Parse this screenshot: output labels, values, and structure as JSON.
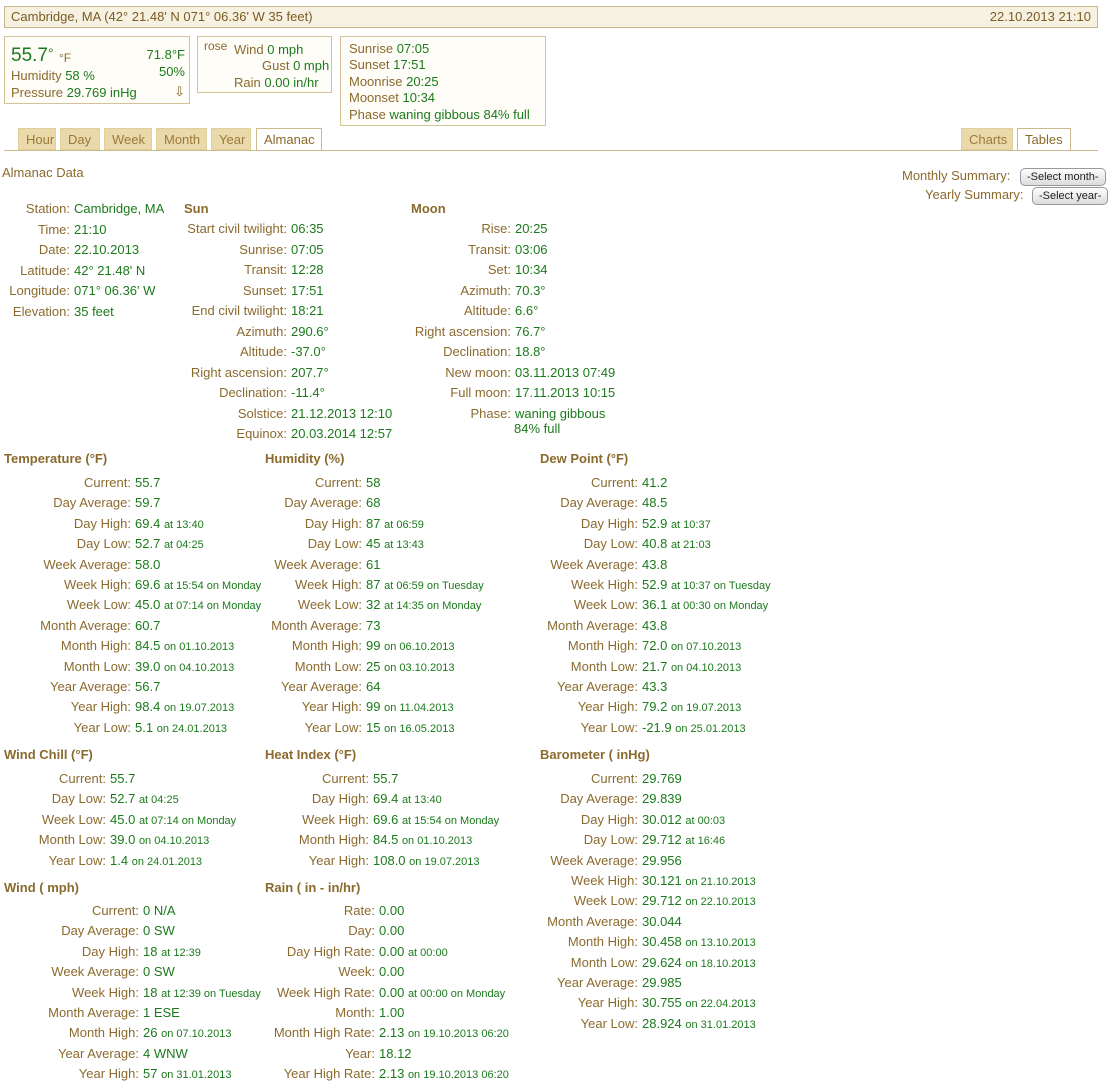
{
  "header": {
    "location": "Cambridge, MA (42° 21.48' N 071° 06.36' W 35 feet)",
    "datetime": "22.10.2013 21:10"
  },
  "current": {
    "temp": "55.7",
    "deg": "°",
    "temp_unit": "°F",
    "high": "71.8°F",
    "high_pct": "50%",
    "humidity_label": "Humidity",
    "humidity": "58 %",
    "pressure_label": "Pressure",
    "pressure": "29.769 inHg",
    "trend_arrow": "⇩"
  },
  "wind_box": {
    "rose": "rose",
    "wind_label": "Wind",
    "wind": "0 mph",
    "gust_label": "Gust",
    "gust": "0 mph",
    "rain_label": "Rain",
    "rain": "0.00 in/hr"
  },
  "sun_box": [
    {
      "label": "Sunrise",
      "value": "07:05"
    },
    {
      "label": "Sunset",
      "value": "17:51"
    },
    {
      "label": "Moonrise",
      "value": "20:25"
    },
    {
      "label": "Moonset",
      "value": "10:34"
    },
    {
      "label": "Phase",
      "value": "waning gibbous 84% full"
    }
  ],
  "tabs": {
    "left": [
      "Hour",
      "Day",
      "Week",
      "Month",
      "Year",
      "Almanac"
    ],
    "right": [
      "Charts",
      "Tables"
    ],
    "active": "Almanac"
  },
  "almanac_title": "Almanac Data",
  "summary": {
    "monthly_label": "Monthly Summary:",
    "monthly_select": "-Select month-",
    "yearly_label": "Yearly Summary:",
    "yearly_select": "-Select year-"
  },
  "station": {
    "rows": [
      {
        "label": "Station:",
        "value": "Cambridge, MA"
      },
      {
        "label": "Time:",
        "value": "21:10"
      },
      {
        "label": "Date:",
        "value": "22.10.2013"
      },
      {
        "label": "Latitude:",
        "value": "42° 21.48' N"
      },
      {
        "label": "Longitude:",
        "value": "071° 06.36' W"
      },
      {
        "label": "Elevation:",
        "value": "35 feet"
      }
    ]
  },
  "sun": {
    "title": "Sun",
    "rows": [
      {
        "label": "Start civil twilight:",
        "value": "06:35"
      },
      {
        "label": "Sunrise:",
        "value": "07:05"
      },
      {
        "label": "Transit:",
        "value": "12:28"
      },
      {
        "label": "Sunset:",
        "value": "17:51"
      },
      {
        "label": "End civil twilight:",
        "value": "18:21"
      },
      {
        "label": "Azimuth:",
        "value": "290.6°"
      },
      {
        "label": "Altitude:",
        "value": "-37.0°"
      },
      {
        "label": "Right ascension:",
        "value": "207.7°"
      },
      {
        "label": "Declination:",
        "value": "-11.4°"
      },
      {
        "label": "Solstice:",
        "value": "21.12.2013 12:10"
      },
      {
        "label": "Equinox:",
        "value": "20.03.2014 12:57"
      }
    ]
  },
  "moon": {
    "title": "Moon",
    "rows": [
      {
        "label": "Rise:",
        "value": "20:25"
      },
      {
        "label": "Transit:",
        "value": "03:06"
      },
      {
        "label": "Set:",
        "value": "10:34"
      },
      {
        "label": "Azimuth:",
        "value": "70.3°"
      },
      {
        "label": "Altitude:",
        "value": "6.6°"
      },
      {
        "label": "Right ascension:",
        "value": "76.7°"
      },
      {
        "label": "Declination:",
        "value": "18.8°"
      },
      {
        "label": "New moon:",
        "value": "03.11.2013 07:49"
      },
      {
        "label": "Full moon:",
        "value": "17.11.2013 10:15"
      },
      {
        "label": "Phase:",
        "value": "waning gibbous"
      }
    ],
    "phase_extra": "84% full"
  },
  "temperature": {
    "title": "Temperature (°F)",
    "rows": [
      {
        "label": "Current:",
        "value": "55.7",
        "extra": ""
      },
      {
        "label": "Day Average:",
        "value": "59.7",
        "extra": ""
      },
      {
        "label": "Day High:",
        "value": "69.4",
        "extra": "at 13:40"
      },
      {
        "label": "Day Low:",
        "value": "52.7",
        "extra": "at 04:25"
      },
      {
        "label": "Week Average:",
        "value": "58.0",
        "extra": ""
      },
      {
        "label": "Week High:",
        "value": "69.6",
        "extra": "at 15:54 on Monday"
      },
      {
        "label": "Week Low:",
        "value": "45.0",
        "extra": "at 07:14 on Monday"
      },
      {
        "label": "Month Average:",
        "value": "60.7",
        "extra": ""
      },
      {
        "label": "Month High:",
        "value": "84.5",
        "extra": "on 01.10.2013"
      },
      {
        "label": "Month Low:",
        "value": "39.0",
        "extra": "on 04.10.2013"
      },
      {
        "label": "Year Average:",
        "value": "56.7",
        "extra": ""
      },
      {
        "label": "Year High:",
        "value": "98.4",
        "extra": "on 19.07.2013"
      },
      {
        "label": "Year Low:",
        "value": "5.1",
        "extra": "on 24.01.2013"
      }
    ]
  },
  "humidity": {
    "title": "Humidity (%)",
    "rows": [
      {
        "label": "Current:",
        "value": "58",
        "extra": ""
      },
      {
        "label": "Day Average:",
        "value": "68",
        "extra": ""
      },
      {
        "label": "Day High:",
        "value": "87",
        "extra": "at 06:59"
      },
      {
        "label": "Day Low:",
        "value": "45",
        "extra": "at 13:43"
      },
      {
        "label": "Week Average:",
        "value": "61",
        "extra": ""
      },
      {
        "label": "Week High:",
        "value": "87",
        "extra": "at 06:59 on Tuesday"
      },
      {
        "label": "Week Low:",
        "value": "32",
        "extra": "at 14:35 on Monday"
      },
      {
        "label": "Month Average:",
        "value": "73",
        "extra": ""
      },
      {
        "label": "Month High:",
        "value": "99",
        "extra": "on 06.10.2013"
      },
      {
        "label": "Month Low:",
        "value": "25",
        "extra": "on 03.10.2013"
      },
      {
        "label": "Year Average:",
        "value": "64",
        "extra": ""
      },
      {
        "label": "Year High:",
        "value": "99",
        "extra": "on 11.04.2013"
      },
      {
        "label": "Year Low:",
        "value": "15",
        "extra": "on 16.05.2013"
      }
    ]
  },
  "dewpoint": {
    "title": "Dew Point (°F)",
    "rows": [
      {
        "label": "Current:",
        "value": "41.2",
        "extra": ""
      },
      {
        "label": "Day Average:",
        "value": "48.5",
        "extra": ""
      },
      {
        "label": "Day High:",
        "value": "52.9",
        "extra": "at 10:37"
      },
      {
        "label": "Day Low:",
        "value": "40.8",
        "extra": "at 21:03"
      },
      {
        "label": "Week Average:",
        "value": "43.8",
        "extra": ""
      },
      {
        "label": "Week High:",
        "value": "52.9",
        "extra": "at 10:37 on Tuesday"
      },
      {
        "label": "Week Low:",
        "value": "36.1",
        "extra": "at 00:30 on Monday"
      },
      {
        "label": "Month Average:",
        "value": "43.8",
        "extra": ""
      },
      {
        "label": "Month High:",
        "value": "72.0",
        "extra": "on 07.10.2013"
      },
      {
        "label": "Month Low:",
        "value": "21.7",
        "extra": "on 04.10.2013"
      },
      {
        "label": "Year Average:",
        "value": "43.3",
        "extra": ""
      },
      {
        "label": "Year High:",
        "value": "79.2",
        "extra": "on 19.07.2013"
      },
      {
        "label": "Year Low:",
        "value": "-21.9",
        "extra": "on 25.01.2013"
      }
    ]
  },
  "windchill": {
    "title": "Wind Chill (°F)",
    "rows": [
      {
        "label": "Current:",
        "value": "55.7",
        "extra": ""
      },
      {
        "label": "Day Low:",
        "value": "52.7",
        "extra": "at 04:25"
      },
      {
        "label": "Week Low:",
        "value": "45.0",
        "extra": "at 07:14 on Monday"
      },
      {
        "label": "Month Low:",
        "value": "39.0",
        "extra": "on 04.10.2013"
      },
      {
        "label": "Year Low:",
        "value": "1.4",
        "extra": "on 24.01.2013"
      }
    ]
  },
  "heatindex": {
    "title": "Heat Index (°F)",
    "rows": [
      {
        "label": "Current:",
        "value": "55.7",
        "extra": ""
      },
      {
        "label": "Day High:",
        "value": "69.4",
        "extra": "at 13:40"
      },
      {
        "label": "Week High:",
        "value": "69.6",
        "extra": "at 15:54 on Monday"
      },
      {
        "label": "Month High:",
        "value": "84.5",
        "extra": "on 01.10.2013"
      },
      {
        "label": "Year High:",
        "value": "108.0",
        "extra": "on 19.07.2013"
      }
    ]
  },
  "barometer": {
    "title": "Barometer ( inHg)",
    "rows": [
      {
        "label": "Current:",
        "value": "29.769",
        "extra": ""
      },
      {
        "label": "Day Average:",
        "value": "29.839",
        "extra": ""
      },
      {
        "label": "Day High:",
        "value": "30.012",
        "extra": "at 00:03"
      },
      {
        "label": "Day Low:",
        "value": "29.712",
        "extra": "at 16:46"
      },
      {
        "label": "Week Average:",
        "value": "29.956",
        "extra": ""
      },
      {
        "label": "Week High:",
        "value": "30.121",
        "extra": "on 21.10.2013"
      },
      {
        "label": "Week Low:",
        "value": "29.712",
        "extra": "on 22.10.2013"
      },
      {
        "label": "Month Average:",
        "value": "30.044",
        "extra": ""
      },
      {
        "label": "Month High:",
        "value": "30.458",
        "extra": "on 13.10.2013"
      },
      {
        "label": "Month Low:",
        "value": "29.624",
        "extra": "on 18.10.2013"
      },
      {
        "label": "Year Average:",
        "value": "29.985",
        "extra": ""
      },
      {
        "label": "Year High:",
        "value": "30.755",
        "extra": "on 22.04.2013"
      },
      {
        "label": "Year Low:",
        "value": "28.924",
        "extra": "on 31.01.2013"
      }
    ]
  },
  "wind": {
    "title": "Wind ( mph)",
    "rows": [
      {
        "label": "Current:",
        "value": "0 N/A",
        "extra": ""
      },
      {
        "label": "Day Average:",
        "value": "0 SW",
        "extra": ""
      },
      {
        "label": "Day High:",
        "value": "18",
        "extra": "at 12:39"
      },
      {
        "label": "Week Average:",
        "value": "0 SW",
        "extra": ""
      },
      {
        "label": "Week High:",
        "value": "18",
        "extra": "at 12:39 on Tuesday"
      },
      {
        "label": "Month Average:",
        "value": "1 ESE",
        "extra": ""
      },
      {
        "label": "Month High:",
        "value": "26",
        "extra": "on 07.10.2013"
      },
      {
        "label": "Year Average:",
        "value": "4 WNW",
        "extra": ""
      },
      {
        "label": "Year High:",
        "value": "57",
        "extra": "on 31.01.2013"
      }
    ]
  },
  "rain": {
    "title": "Rain ( in - in/hr)",
    "rows": [
      {
        "label": "Rate:",
        "value": "0.00",
        "extra": ""
      },
      {
        "label": "Day:",
        "value": "0.00",
        "extra": ""
      },
      {
        "label": "Day High Rate:",
        "value": "0.00",
        "extra": "at 00:00"
      },
      {
        "label": "Week:",
        "value": "0.00",
        "extra": ""
      },
      {
        "label": "Week High Rate:",
        "value": "0.00",
        "extra": "at 00:00 on Monday"
      },
      {
        "label": "Month:",
        "value": "1.00",
        "extra": ""
      },
      {
        "label": "Month High Rate:",
        "value": "2.13",
        "extra": "on 19.10.2013 06:20"
      },
      {
        "label": "Year:",
        "value": "18.12",
        "extra": ""
      },
      {
        "label": "Year High Rate:",
        "value": "2.13",
        "extra": "on 19.10.2013 06:20"
      }
    ]
  }
}
